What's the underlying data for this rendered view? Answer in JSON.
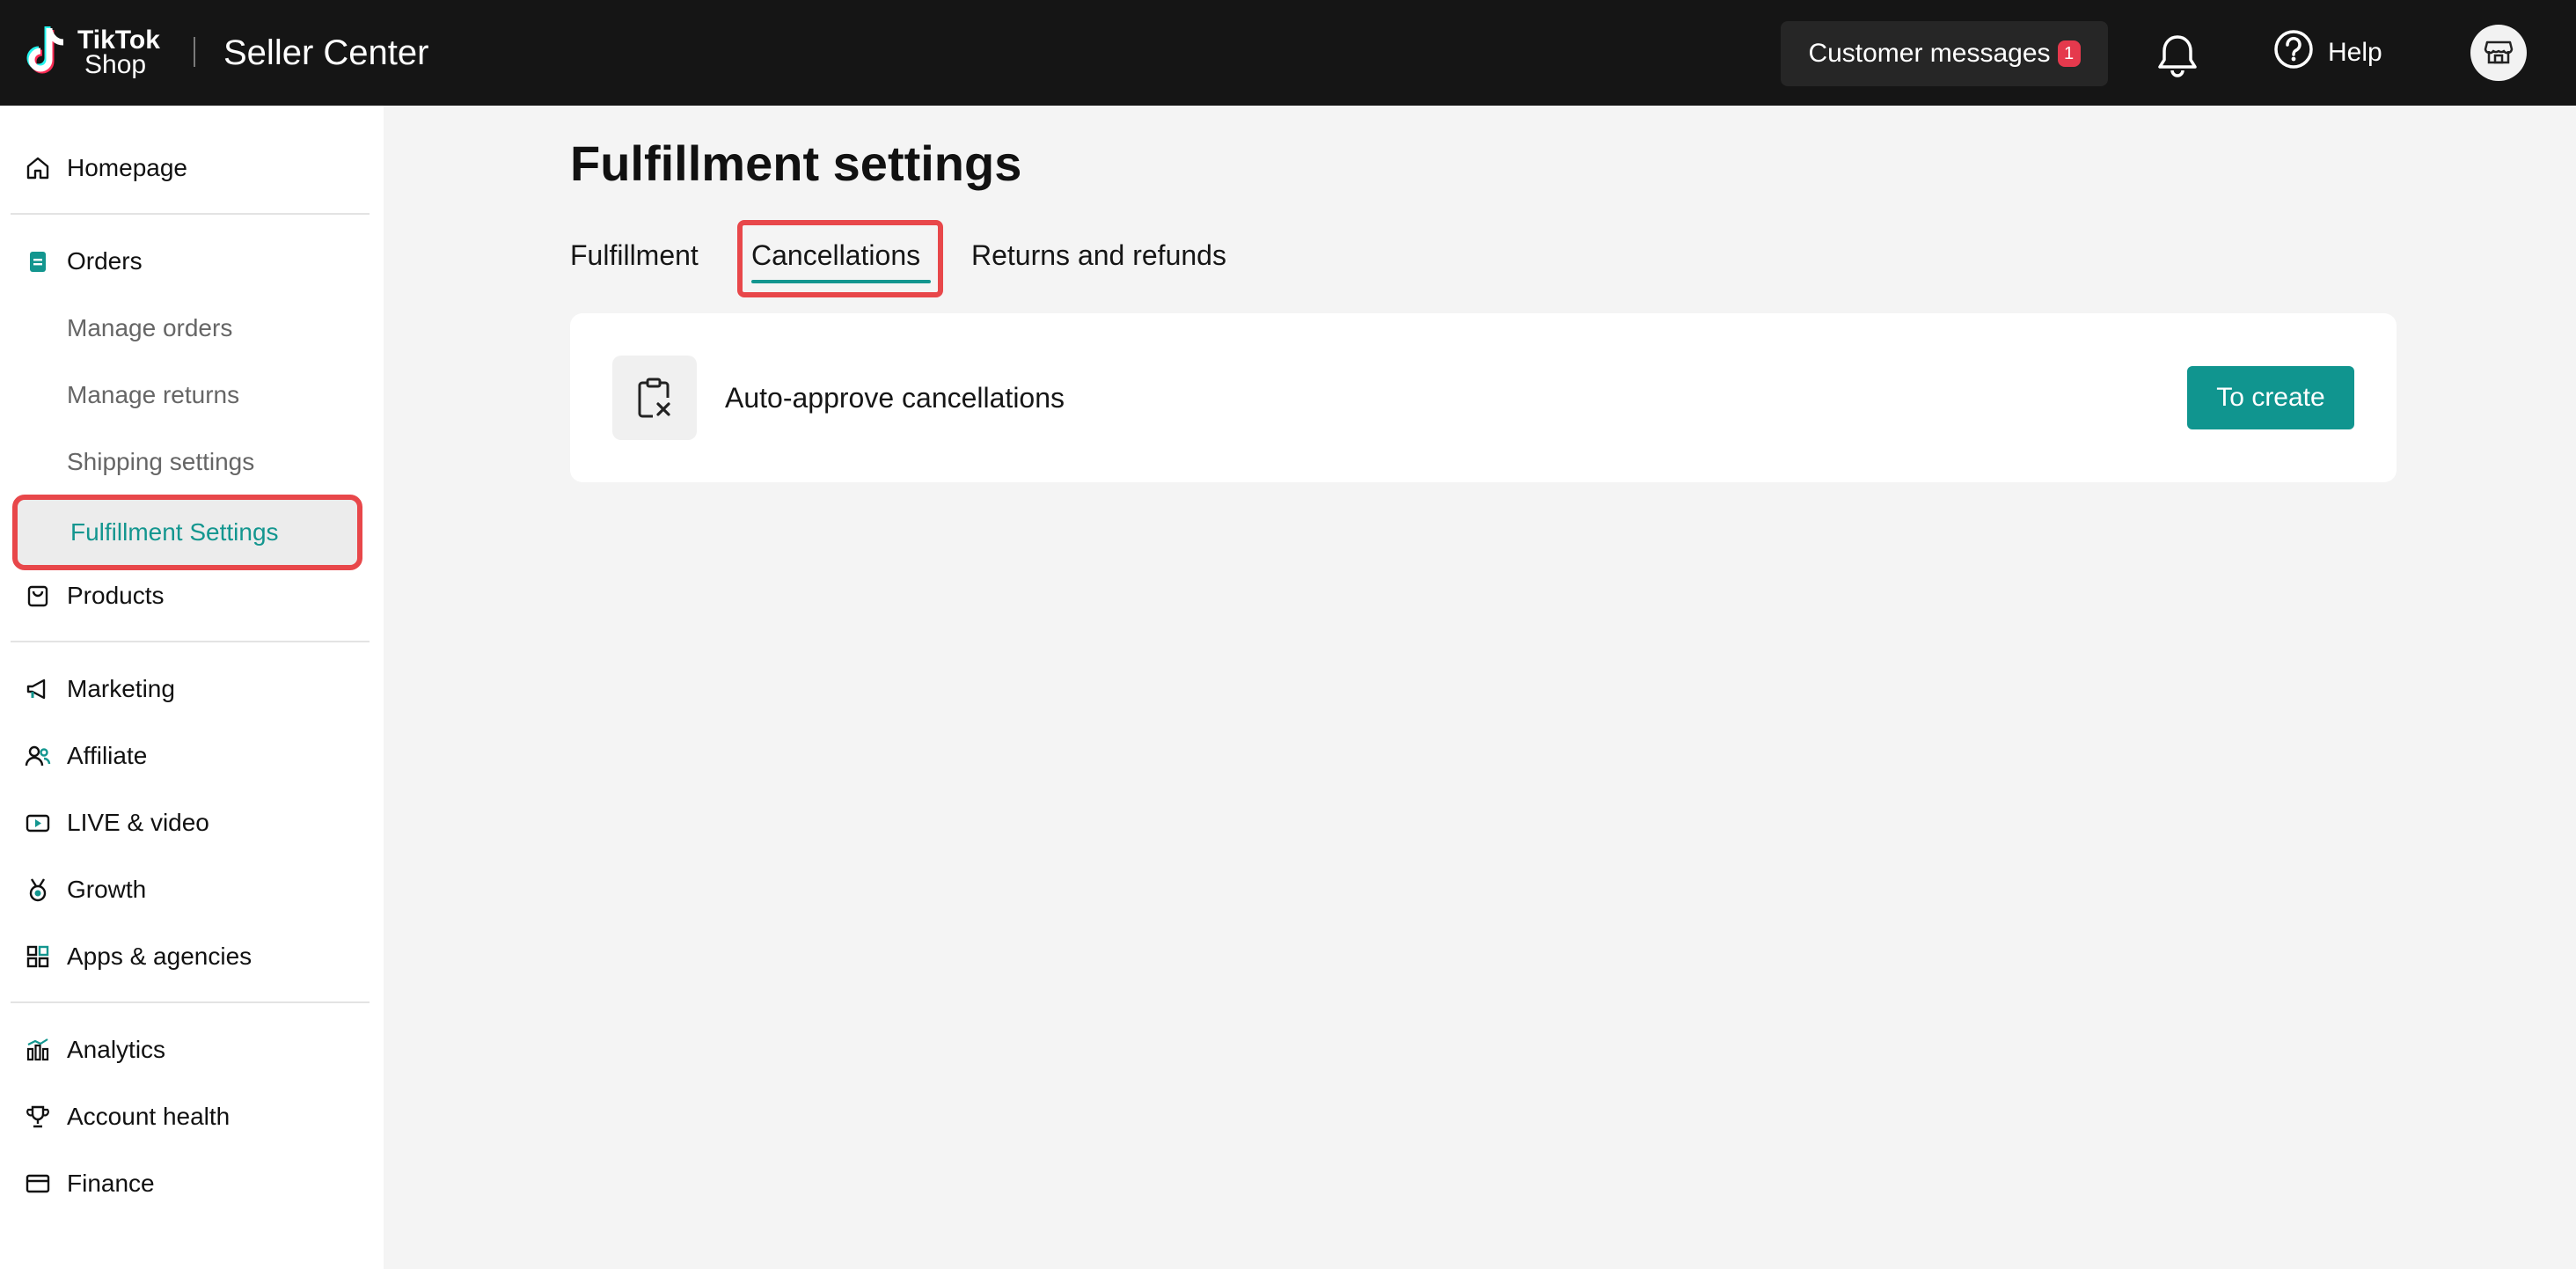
{
  "header": {
    "logo_line1": "TikTok",
    "logo_line2": "Shop",
    "app_title": "Seller Center",
    "customer_messages_label": "Customer messages",
    "customer_messages_count": "1",
    "help_label": "Help",
    "icons": [
      "tiktok-logo-icon",
      "bell-icon",
      "help-circle-icon",
      "store-icon"
    ]
  },
  "sidebar": {
    "homepage": "Homepage",
    "orders": "Orders",
    "orders_sub": {
      "manage_orders": "Manage orders",
      "manage_returns": "Manage returns",
      "shipping_settings": "Shipping settings",
      "fulfillment_settings": "Fulfillment Settings"
    },
    "products": "Products",
    "marketing": "Marketing",
    "affiliate": "Affiliate",
    "live_video": "LIVE & video",
    "growth": "Growth",
    "apps_agencies": "Apps & agencies",
    "analytics": "Analytics",
    "account_health": "Account health",
    "finance": "Finance"
  },
  "main": {
    "title": "Fulfillment settings",
    "tabs": [
      "Fulfillment",
      "Cancellations",
      "Returns and refunds"
    ],
    "active_tab": "Cancellations",
    "card": {
      "label": "Auto-approve cancellations",
      "button_label": "To create",
      "icon": "clipboard-x-icon"
    }
  },
  "colors": {
    "accent": "#13968f",
    "topbar": "#151515",
    "highlight": "#e8474a",
    "badge": "#e5394d"
  }
}
